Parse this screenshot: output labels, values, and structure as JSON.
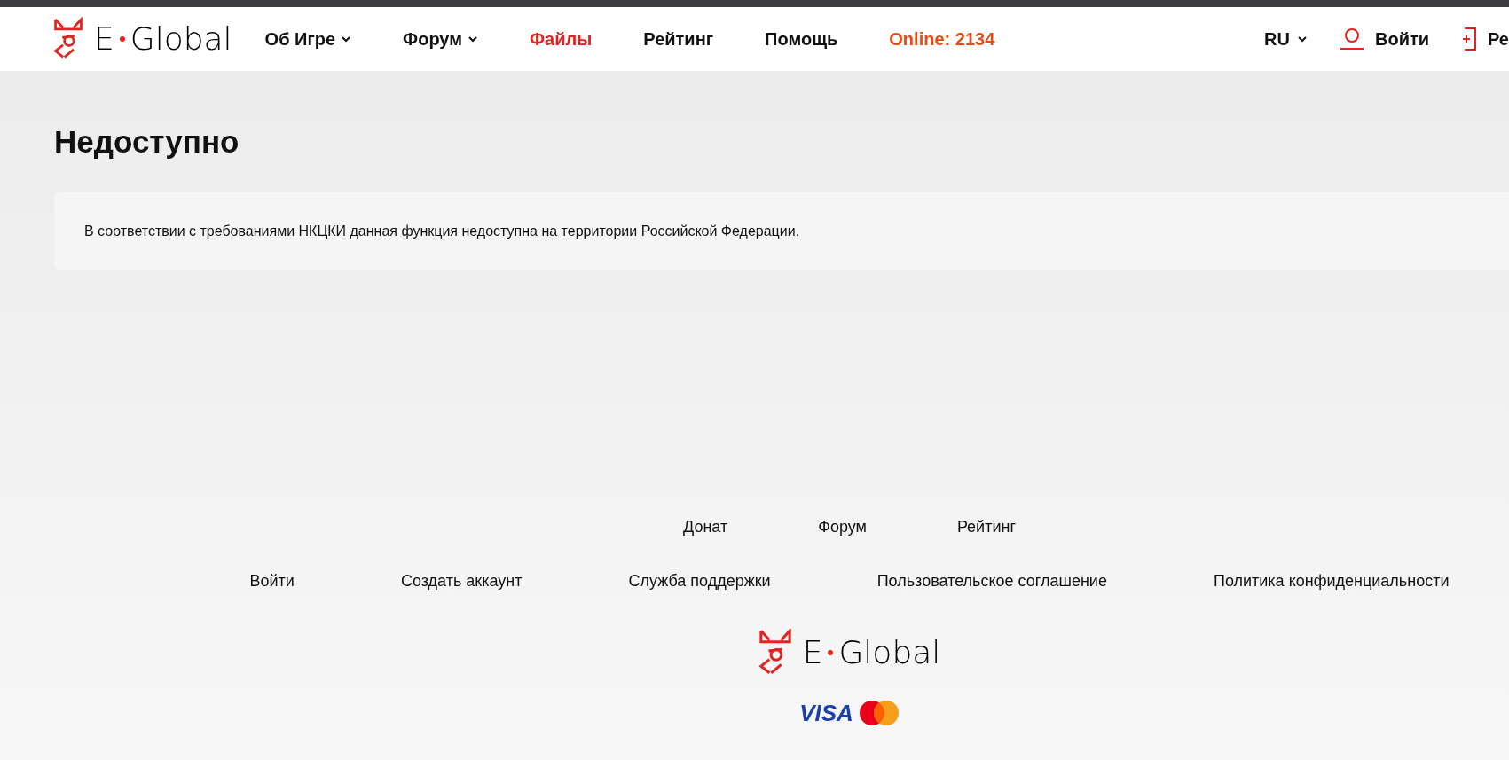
{
  "header": {
    "logo": {
      "left": "E",
      "right": "Global"
    },
    "nav": [
      {
        "label": "Об Игре",
        "kind": "dropdown",
        "color": "#111111"
      },
      {
        "label": "Форум",
        "kind": "dropdown",
        "color": "#111111"
      },
      {
        "label": "Файлы",
        "kind": "link",
        "color": "#e3231f"
      },
      {
        "label": "Рейтинг",
        "kind": "link",
        "color": "#111111"
      },
      {
        "label": "Помощь",
        "kind": "link",
        "color": "#111111"
      },
      {
        "label": "Online: 2134",
        "kind": "link",
        "color": "#ec4a12"
      }
    ],
    "language": "RU",
    "login": "Войти",
    "register": "Ре"
  },
  "page": {
    "title": "Недоступно",
    "message": "В соответствии с требованиями НКЦКИ данная функция недоступна на территории Российской Федерации."
  },
  "footer": {
    "links_top": [
      "Донат",
      "Форум",
      "Рейтинг"
    ],
    "links_bottom": [
      "Войти",
      "Создать аккаунт",
      "Служба поддержки",
      "Пользовательское соглашение",
      "Политика конфиденциальности"
    ],
    "logo": {
      "left": "E",
      "right": "Global"
    },
    "payment": {
      "visa": "VISA"
    }
  }
}
